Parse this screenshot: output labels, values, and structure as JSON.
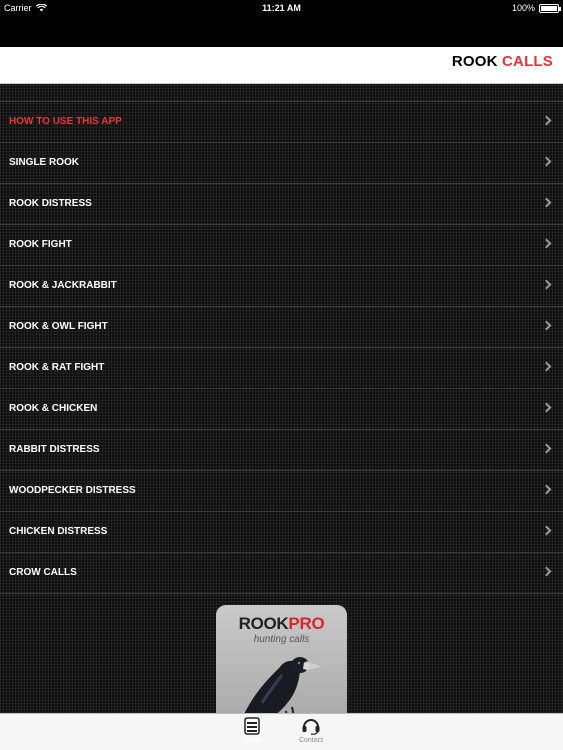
{
  "status_bar": {
    "carrier": "Carrier",
    "time": "11:21 AM",
    "battery": "100%"
  },
  "nav": {
    "title_part1": "ROOK",
    "title_part2": "CALLS",
    "accent_color": "#e8343a"
  },
  "menu": {
    "items": [
      {
        "label": "HOW TO USE THIS APP",
        "accent": true
      },
      {
        "label": "SINGLE ROOK"
      },
      {
        "label": "ROOK DISTRESS"
      },
      {
        "label": "ROOK FIGHT"
      },
      {
        "label": "ROOK & JACKRABBIT"
      },
      {
        "label": "ROOK & OWL FIGHT"
      },
      {
        "label": "ROOK & RAT FIGHT"
      },
      {
        "label": "ROOK & CHICKEN"
      },
      {
        "label": "RABBIT DISTRESS"
      },
      {
        "label": "WOODPECKER DISTRESS"
      },
      {
        "label": "CHICKEN DISTRESS"
      },
      {
        "label": "CROW CALLS"
      }
    ]
  },
  "promo": {
    "brand_part1": "ROOK",
    "brand_part2": "PRO",
    "subtitle": "hunting calls"
  },
  "tab_bar": {
    "tabs": [
      {
        "label": "Menu",
        "icon": "menu-icon",
        "active": true
      },
      {
        "label": "Contact",
        "icon": "headset-icon",
        "active": false
      }
    ]
  }
}
